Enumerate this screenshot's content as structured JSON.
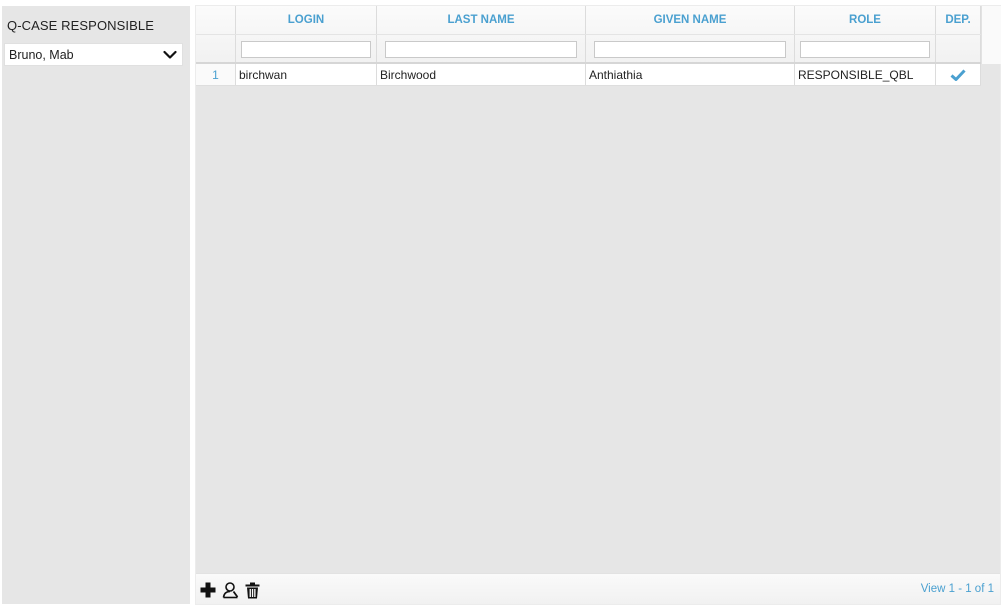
{
  "left_panel": {
    "title": "Q-CASE RESPONSIBLE",
    "selected_responsible": "Bruno, Mab"
  },
  "grid": {
    "columns": [
      {
        "key": "login",
        "label": "LOGIN"
      },
      {
        "key": "last_name",
        "label": "LAST NAME"
      },
      {
        "key": "given_name",
        "label": "GIVEN NAME"
      },
      {
        "key": "role",
        "label": "ROLE"
      },
      {
        "key": "dep",
        "label": "DEP."
      }
    ],
    "rows": [
      {
        "num": "1",
        "login": "birchwan",
        "last_name": "Birchwood",
        "given_name": "Anthiathia",
        "role": "RESPONSIBLE_QBL",
        "dep": true
      }
    ],
    "pager": "View 1 - 1 of 1"
  },
  "icons": {
    "add": "plus-icon",
    "user_search": "user-search-icon",
    "delete": "trash-icon",
    "dep_checked": "checkmark-icon",
    "dropdown": "chevron-down-icon"
  },
  "colors": {
    "accent": "#4aa0d0",
    "panel_bg": "#e6e6e6",
    "text": "#222222"
  }
}
